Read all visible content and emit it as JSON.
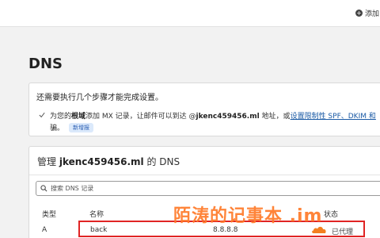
{
  "topbar": {
    "add_site_label": "添加"
  },
  "page": {
    "title": "DNS"
  },
  "setup": {
    "heading": "还需要执行几个步骤才能完成设置。",
    "item_prefix": "为您的",
    "item_bold1": "根域",
    "item_mid": "添加 MX 记录，让邮件可以到达 @",
    "item_domain": "jkenc459456.ml",
    "item_after": " 地址，或",
    "item_link": "设置限制性 SPF、DKIM 和",
    "item_line2": "骗。",
    "badge": "新增报"
  },
  "dns": {
    "heading_prefix": "管理 ",
    "domain": "jkenc459456.ml",
    "heading_suffix": " 的 DNS",
    "search_placeholder": "搜索 DNS 记录",
    "columns": {
      "type": "类型",
      "name": "名称",
      "status": "状态"
    },
    "records": [
      {
        "type": "A",
        "name": "back",
        "content": "8.8.8.8",
        "proxy_status": "已代理"
      }
    ]
  },
  "watermark": "陌涛的记事本 .im",
  "colors": {
    "highlight": "#e02424",
    "cloud": "#f38020",
    "link": "#1a5aa5",
    "watermark": "#ff7a29"
  }
}
